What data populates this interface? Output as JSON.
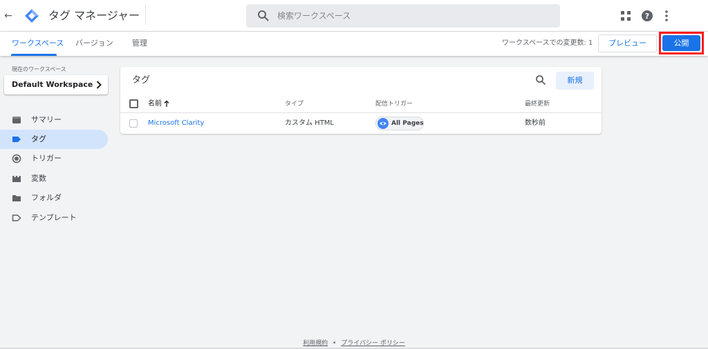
{
  "header": {
    "app_title": "タグ マネージャー",
    "search_placeholder": "検索ワークスペース",
    "icons": {
      "back": "back-arrow-icon",
      "logo": "tag-manager-logo",
      "search": "search-icon",
      "apps": "apps-grid-icon",
      "help": "help-icon",
      "more": "more-vert-icon"
    }
  },
  "subnav": {
    "tabs": [
      {
        "label": "ワークスペース",
        "active": true
      },
      {
        "label": "バージョン",
        "active": false
      },
      {
        "label": "管理",
        "active": false
      }
    ],
    "changes_text": "ワークスペースでの変更数: 1",
    "preview_label": "プレビュー",
    "publish_label": "公開"
  },
  "sidebar": {
    "workspace_label": "現在のワークスペース",
    "workspace_name": "Default Workspace",
    "items": [
      {
        "label": "サマリー",
        "icon": "summary-icon",
        "active": false
      },
      {
        "label": "タグ",
        "icon": "tag-icon",
        "active": true
      },
      {
        "label": "トリガー",
        "icon": "trigger-icon",
        "active": false
      },
      {
        "label": "変数",
        "icon": "variable-icon",
        "active": false
      },
      {
        "label": "フォルダ",
        "icon": "folder-icon",
        "active": false
      },
      {
        "label": "テンプレート",
        "icon": "template-icon",
        "active": false
      }
    ]
  },
  "tags_card": {
    "title": "タグ",
    "new_label": "新規",
    "columns": [
      "名前",
      "タイプ",
      "配信トリガー",
      "最終更新"
    ],
    "rows": [
      {
        "name": "Microsoft Clarity",
        "type": "カスタム HTML",
        "trigger": "All Pages",
        "updated": "数秒前"
      }
    ]
  },
  "footer": {
    "terms": "利用規約",
    "separator": "•",
    "privacy": "プライバシー ポリシー"
  },
  "colors": {
    "accent": "#1a73e8",
    "highlight": "#ff1a1a",
    "nav_active": "#d2e3fc"
  }
}
